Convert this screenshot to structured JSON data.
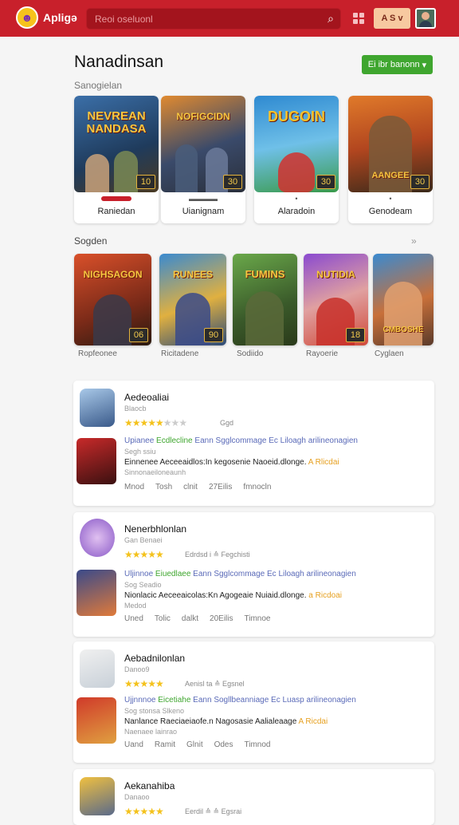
{
  "header": {
    "app_name": "Apligə",
    "search_placeholder": "Reoi oseluonl",
    "lang_label": "A S",
    "lang_chevron": "v"
  },
  "main": {
    "title": "Nanadinsan",
    "cta_label": "Ei ibr banonn",
    "cta_chevron": "▾",
    "section1": "Sanogielan",
    "section2": "Sogden",
    "section2_more": "»",
    "featured": [
      {
        "art_title": "NEVREAN NANDASA",
        "badge": "10",
        "name": "Raniedan",
        "sub": ""
      },
      {
        "art_title": "NOFIGCIDN",
        "badge": "30",
        "name": "Uianignam",
        "sub": "▬▬▬▬"
      },
      {
        "art_title": "DUGOIN",
        "badge": "30",
        "name": "Alaradoin",
        "sub": "•"
      },
      {
        "art_title": "AANGEE",
        "badge": "30",
        "name": "Genodeam",
        "sub": "•"
      }
    ],
    "row": [
      {
        "art_title": "NIGHSAGON",
        "badge": "06",
        "name": "Ropfeonee"
      },
      {
        "art_title": "RUNEES",
        "badge": "90",
        "name": "Ricitadene"
      },
      {
        "art_title": "FUMINS",
        "badge": "",
        "name": "Sodiido"
      },
      {
        "art_title": "NUTIDIA",
        "badge": "18",
        "name": "Rayoerie"
      },
      {
        "art_title": "CMBOSHE",
        "badge": "",
        "name": "Cyglaen"
      }
    ],
    "list": [
      {
        "title": "Aedeoaliai",
        "sub": "Blaocb",
        "stars_on": "★★★★★",
        "stars_off": "★★★",
        "rating_extra": "Ggd",
        "desc1_a": "Upianee ",
        "desc1_b": "Ecdlecline",
        "desc1_c": " Eann Sgglcommage Ec Liloagh arilineonagien",
        "desc2": "Segh ssiu",
        "desc3_a": "Einnenee Aeceeaidlos:In kegosenie Naoeid.dlonge. ",
        "desc3_b": "A Rlicdai",
        "desc4": "Sinnonaeiloneaunh",
        "meta_a": "Mnod",
        "meta_b": "Tosh",
        "meta_c": "clnit",
        "meta_d": "27Eilis",
        "meta_e": "fmnocln"
      },
      {
        "title": "Nenerbhlonlan",
        "sub": "Gan Benaei",
        "stars_on": "★★★★★",
        "stars_off": "",
        "rating_extra": "Edrdsd i ≙ Fegchisti",
        "desc1_a": "Uljinnoe ",
        "desc1_b": "Eiuedlaee",
        "desc1_c": " Eann Sgglcommage Ec Liloagh arilineonagien",
        "desc2": "Sog Seadio",
        "desc3_a": "Nionlacic Aeceeaicolas:Kn Agogeaie Nuiaid.dlonge. ",
        "desc3_b": "a Ricdoai",
        "desc4": "Medod",
        "meta_a": "Uned",
        "meta_b": "Tolic",
        "meta_c": "dalkt",
        "meta_d": "20Eilis",
        "meta_e": "Timnoe"
      },
      {
        "title": "Aebadnilonlan",
        "sub": "Danoo9",
        "stars_on": "★★★★★",
        "stars_off": "",
        "rating_extra": "Aenisl ta ≙ Egsnel",
        "desc1_a": "Ujjnnnoe ",
        "desc1_b": "Eicetiahe",
        "desc1_c": " Eann Sogllbeanniage Ec Luasp arilineonagien",
        "desc2": "Sog stonsa Slkeno",
        "desc3_a": "Nanlance Raeciaeiaofe.n Nagosasie Aalialeaage ",
        "desc3_b": "A Ricdai",
        "desc4": "Naenaee lainrao",
        "meta_a": "Uand",
        "meta_b": "Ramit",
        "meta_c": "Glnit",
        "meta_d": "Odes",
        "meta_e": "Timnod"
      },
      {
        "title": "Aekanahiba",
        "sub": "Danaoo",
        "stars_on": "★★★★★",
        "stars_off": "",
        "rating_extra": "Eerdil ≙ ≙ Egsrai"
      }
    ]
  },
  "colors": {
    "brand": "#c8202b",
    "cta": "#3fa62f",
    "star": "#f4c21c",
    "link": "#5a6ab8"
  },
  "icons": [
    "search-icon",
    "grid-icon",
    "chevron-down-icon",
    "star-icon",
    "avatar"
  ]
}
